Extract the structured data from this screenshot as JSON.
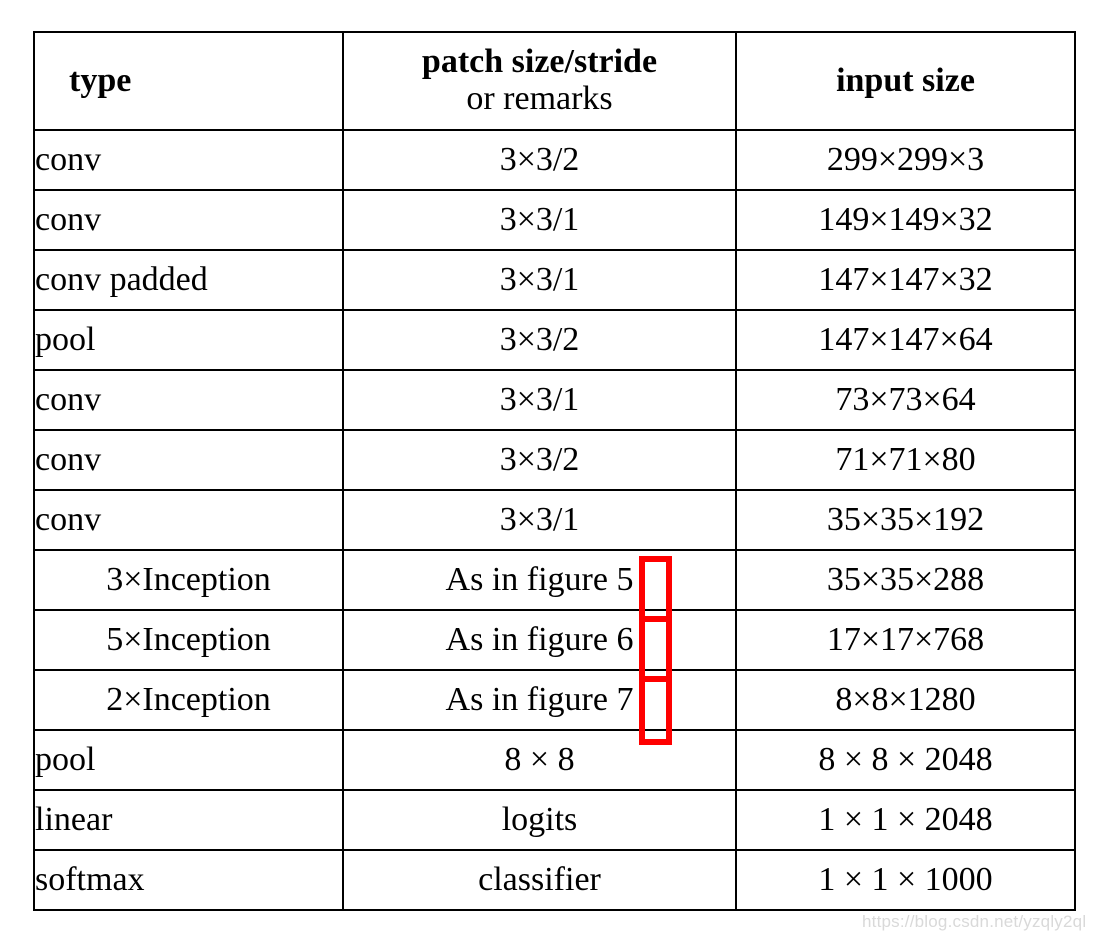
{
  "figure": {
    "title": "Inception network outline table",
    "accent_color": "#ff0000",
    "text_color": "#000000",
    "background_color": "#ffffff"
  },
  "table": {
    "columns": [
      {
        "key": "type",
        "header": "type",
        "header_sub": ""
      },
      {
        "key": "patch",
        "header": "patch size/stride",
        "header_sub": "or remarks"
      },
      {
        "key": "input",
        "header": "input size",
        "header_sub": ""
      }
    ],
    "rows": [
      {
        "type": "conv",
        "patch": "3×3/2",
        "input": "299×299×3"
      },
      {
        "type": "conv",
        "patch": "3×3/1",
        "input": "149×149×32"
      },
      {
        "type": "conv padded",
        "patch": "3×3/1",
        "input": "147×147×32"
      },
      {
        "type": "pool",
        "patch": "3×3/2",
        "input": "147×147×64"
      },
      {
        "type": "conv",
        "patch": "3×3/1",
        "input": "73×73×64"
      },
      {
        "type": "conv",
        "patch": "3×3/2",
        "input": "71×71×80"
      },
      {
        "type": "conv",
        "patch": "3×3/1",
        "input": "35×35×192"
      },
      {
        "type": "3×Inception",
        "patch": "As in figure 5",
        "input": "35×35×288"
      },
      {
        "type": "5×Inception",
        "patch": "As in figure 6",
        "input": "17×17×768"
      },
      {
        "type": "2×Inception",
        "patch": "As in figure 7",
        "input": "8×8×1280"
      },
      {
        "type": "pool",
        "patch": "8 × 8",
        "input": "8 × 8 × 2048"
      },
      {
        "type": "linear",
        "patch": "logits",
        "input": "1 × 1 × 2048"
      },
      {
        "type": "softmax",
        "patch": "classifier",
        "input": "1 × 1 × 1000"
      }
    ]
  },
  "annotations": {
    "highlight_color": "#ff0000",
    "boxes": [
      {
        "id": "fig5",
        "label": "5",
        "target": "As in figure 5"
      },
      {
        "id": "fig6",
        "label": "6",
        "target": "As in figure 6"
      },
      {
        "id": "fig7",
        "label": "7",
        "target": "As in figure 7"
      }
    ]
  },
  "watermark": {
    "text": "https://blog.csdn.net/yzqly2ql"
  }
}
